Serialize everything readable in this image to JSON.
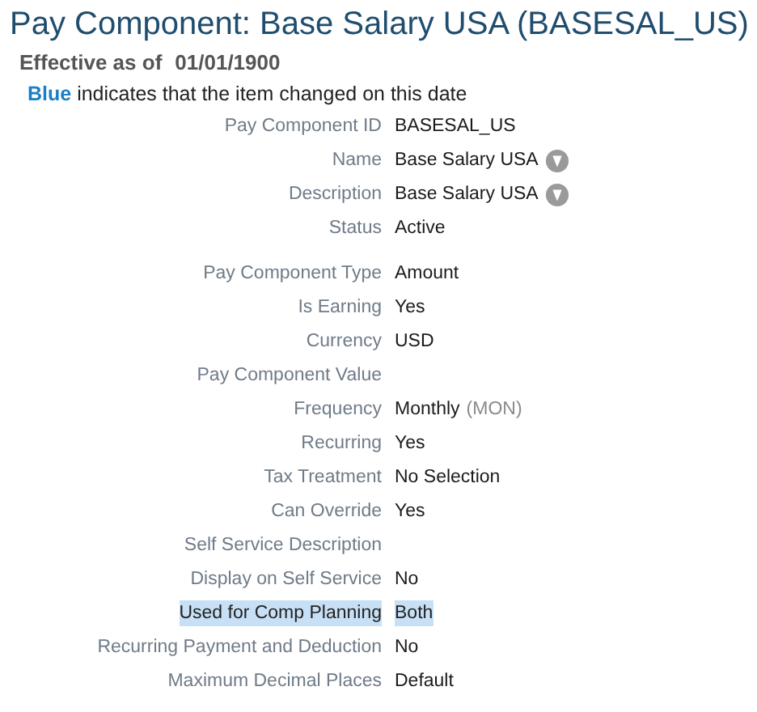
{
  "title": "Pay Component: Base Salary USA (BASESAL_US)",
  "effective": {
    "label": "Effective as of",
    "date": "01/01/1900"
  },
  "legend": {
    "key": "Blue",
    "text": "indicates that the item changed on this date"
  },
  "groups": [
    {
      "fields": [
        {
          "label": "Pay Component ID",
          "value": "BASESAL_US",
          "translatable": false,
          "highlighted": false
        },
        {
          "label": "Name",
          "value": "Base Salary USA",
          "translatable": true,
          "highlighted": false
        },
        {
          "label": "Description",
          "value": "Base Salary USA",
          "translatable": true,
          "highlighted": false
        },
        {
          "label": "Status",
          "value": "Active",
          "translatable": false,
          "highlighted": false
        }
      ]
    },
    {
      "fields": [
        {
          "label": "Pay Component Type",
          "value": "Amount",
          "translatable": false,
          "highlighted": false
        },
        {
          "label": "Is Earning",
          "value": "Yes",
          "translatable": false,
          "highlighted": false
        },
        {
          "label": "Currency",
          "value": "USD",
          "translatable": false,
          "highlighted": false
        },
        {
          "label": "Pay Component Value",
          "translatable": false,
          "highlighted": false
        },
        {
          "label": "Frequency",
          "value": "Monthly",
          "code": "(MON)",
          "translatable": false,
          "highlighted": false
        },
        {
          "label": "Recurring",
          "value": "Yes",
          "translatable": false,
          "highlighted": false
        },
        {
          "label": "Tax Treatment",
          "value": "No Selection",
          "translatable": false,
          "highlighted": false
        },
        {
          "label": "Can Override",
          "value": "Yes",
          "translatable": false,
          "highlighted": false
        },
        {
          "label": "Self Service Description",
          "translatable": false,
          "highlighted": false
        },
        {
          "label": "Display on Self Service",
          "value": "No",
          "translatable": false,
          "highlighted": false
        },
        {
          "label": "Used for Comp Planning",
          "value": "Both",
          "translatable": false,
          "highlighted": true
        },
        {
          "label": "Recurring Payment and Deduction",
          "value": "No",
          "translatable": false,
          "highlighted": false
        },
        {
          "label": "Maximum Decimal Places",
          "value": "Default",
          "translatable": false,
          "highlighted": false
        }
      ]
    }
  ]
}
